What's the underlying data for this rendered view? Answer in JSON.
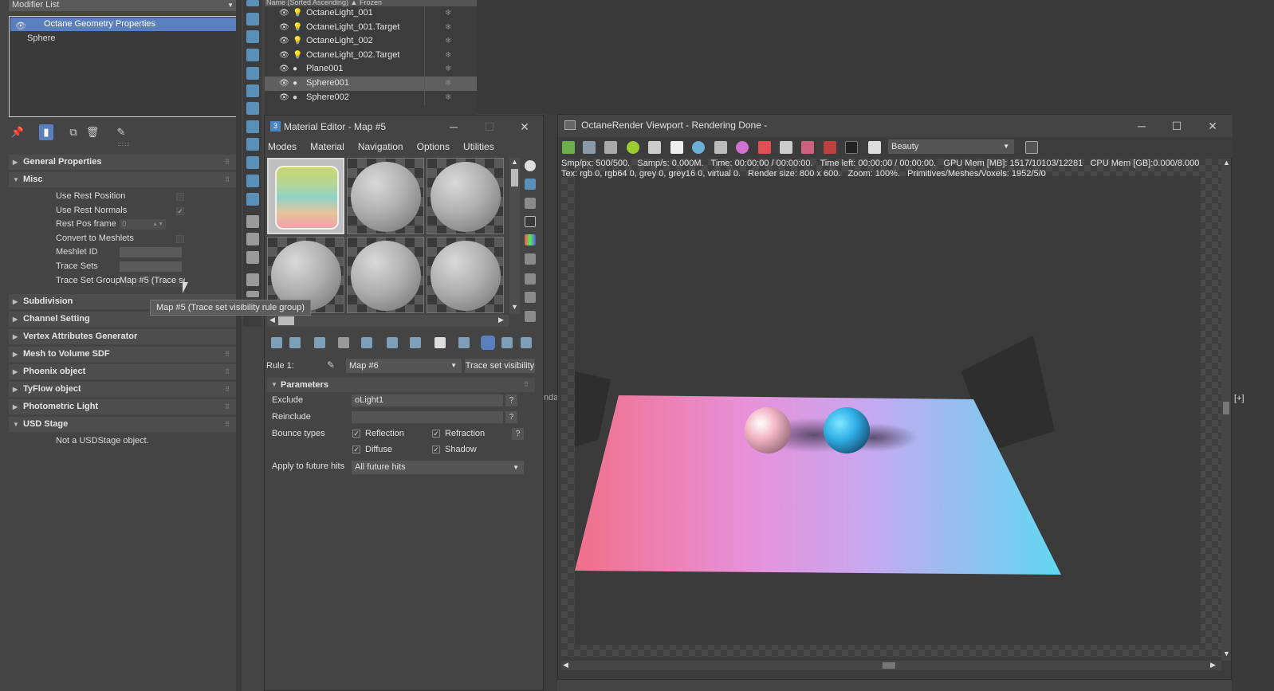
{
  "modifier_panel": {
    "modifier_list_label": "Modifier List",
    "stack": [
      {
        "label": "Octane Geometry Properties",
        "selected": true
      },
      {
        "label": "Sphere",
        "selected": false
      }
    ]
  },
  "rollouts": {
    "general": "General Properties",
    "misc": "Misc",
    "misc_props": {
      "use_rest_position": "Use Rest Position",
      "use_rest_normals": "Use Rest Normals",
      "rest_pos_frame": "Rest Pos frame",
      "rest_pos_frame_value": "0",
      "convert_to_meshlets": "Convert to Meshlets",
      "meshlet_id": "Meshlet ID",
      "trace_sets": "Trace Sets",
      "trace_set_group": "Trace Set Group",
      "trace_set_group_value": "Map #5 (Trace se"
    },
    "subdivision": "Subdivision",
    "channel_setting": "Channel Setting",
    "vertex_attr": "Vertex Attributes Generator",
    "mesh_to_volume": "Mesh to Volume SDF",
    "phoenix": "Phoenix object",
    "tyflow": "TyFlow object",
    "photometric": "Photometric Light",
    "usd_stage": "USD Stage",
    "usd_stage_text": "Not a USDStage object."
  },
  "tooltip": "Map #5 (Trace set visibility rule group)",
  "scene_explorer": {
    "header": "Name (Sorted Ascending)          ▲ Frozen",
    "rows": [
      {
        "name": "OctaneLight_001",
        "selected": false
      },
      {
        "name": "OctaneLight_001.Target",
        "selected": false
      },
      {
        "name": "OctaneLight_002",
        "selected": false
      },
      {
        "name": "OctaneLight_002.Target",
        "selected": false
      },
      {
        "name": "Plane001",
        "selected": false
      },
      {
        "name": "Sphere001",
        "selected": true
      },
      {
        "name": "Sphere002",
        "selected": false
      }
    ]
  },
  "material_editor": {
    "title": "Material Editor - Map #5",
    "icon_label": "3",
    "menu": [
      "Modes",
      "Material",
      "Navigation",
      "Options",
      "Utilities"
    ],
    "rule_label": "Rule 1:",
    "rule_map": "Map #6",
    "rule_button": "Trace set visibility",
    "params_title": "Parameters",
    "exclude_label": "Exclude",
    "exclude_value": "oLight1",
    "reinclude_label": "Reinclude",
    "reinclude_value": "",
    "bounce_label": "Bounce types",
    "bounce": {
      "reflection": "Reflection",
      "refraction": "Refraction",
      "diffuse": "Diffuse",
      "shadow": "Shadow"
    },
    "apply_label": "Apply to future hits",
    "apply_value": "All future hits",
    "help": "?"
  },
  "octane": {
    "title": "OctaneRender Viewport - Rendering Done -",
    "pass": "Beauty",
    "status_line1": "Smp/px: 500/500.   Samp/s: 0.000M.   Time: 00:00:00 / 00:00:00.   Time left: 00:00:00 / 00:00:00.   GPU Mem [MB]: 1517/10103/12281   CPU Mem [GB]:0.000/8.000",
    "status_line2": "Tex: rgb 0, rgb64 0, grey 0, grey16 0, virtual 0.   Render size: 800 x 600.   Zoom: 100%.   Primitives/Meshes/Voxels: 1952/5/0"
  },
  "viewport_label": "[+]",
  "mid_label": "nda",
  "colors": {
    "selection_blue": "#5a7fbf",
    "panel_bg": "#444444",
    "dark_bg": "#3a3a3a"
  }
}
